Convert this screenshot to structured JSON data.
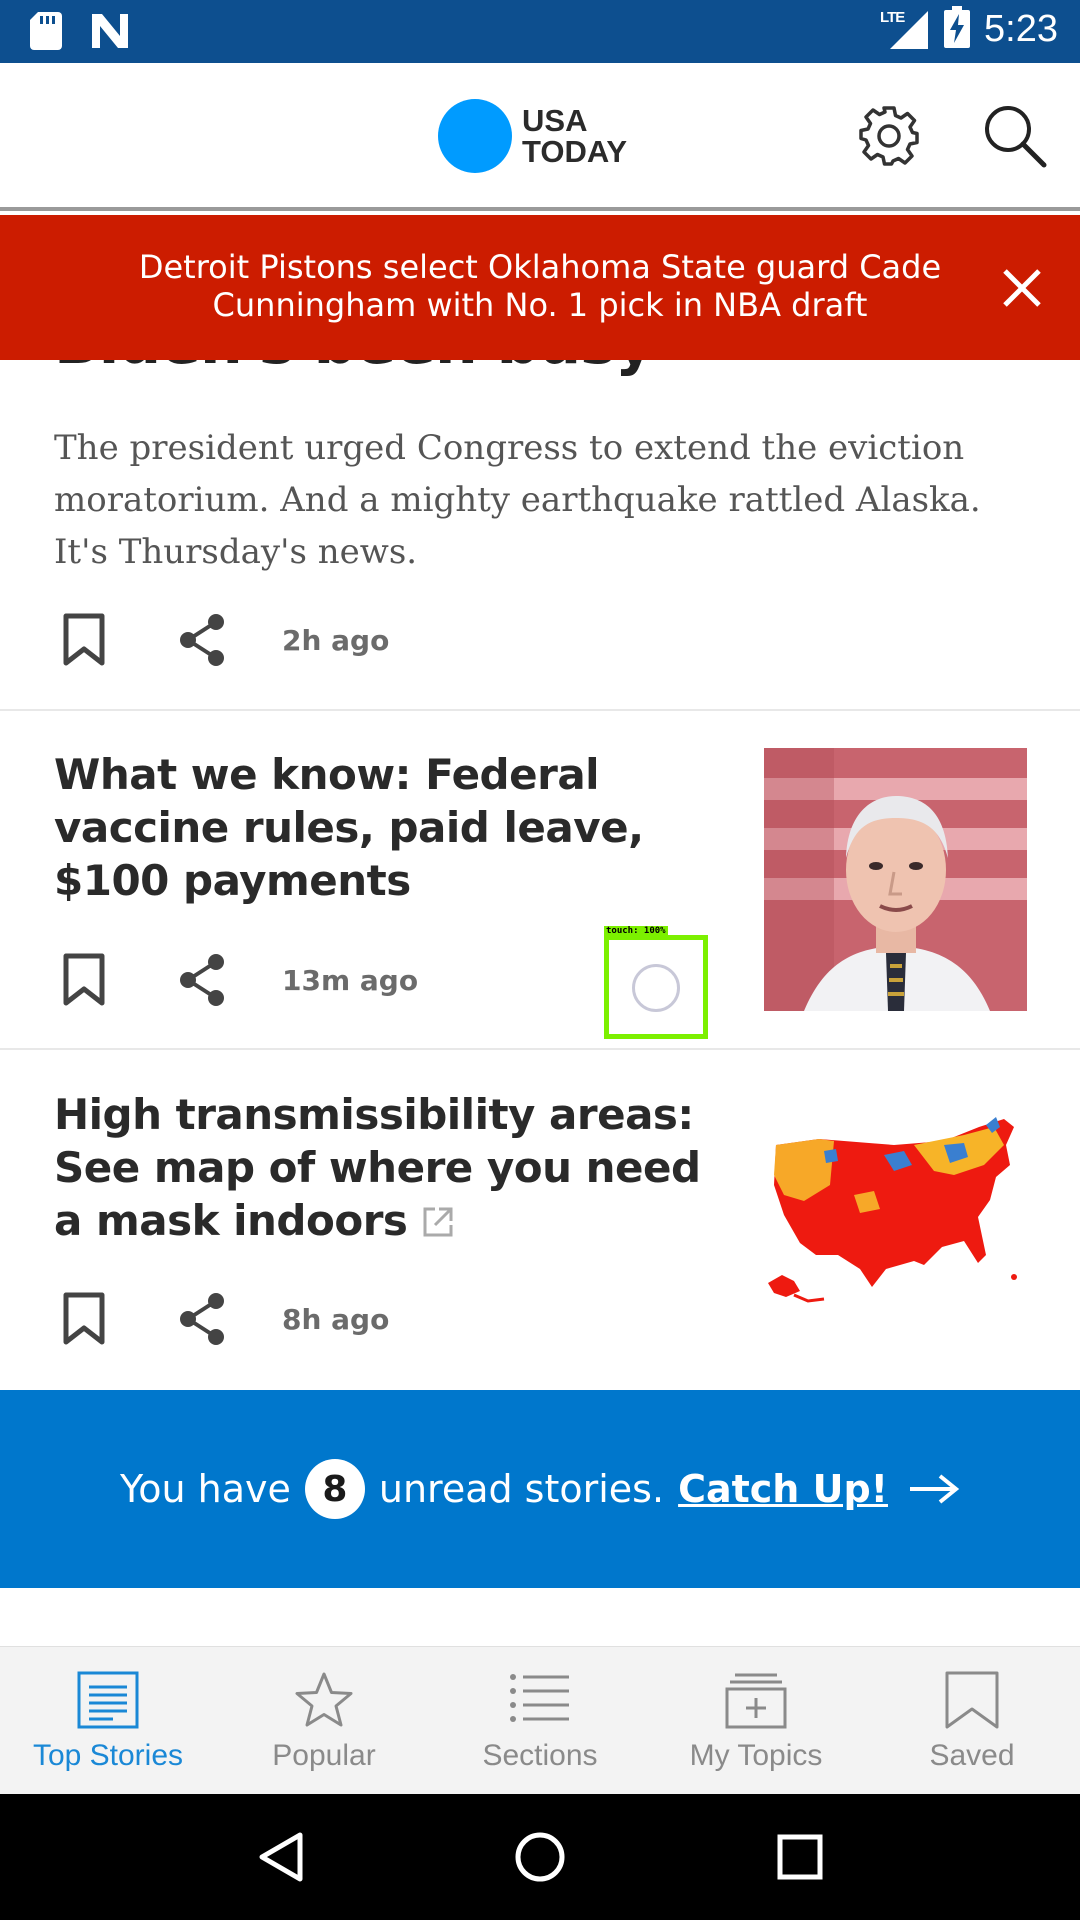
{
  "status_bar": {
    "time": "5:23",
    "network": "LTE",
    "icons": [
      "sd-card-icon",
      "n-notification-icon",
      "signal-icon",
      "battery-charging-icon"
    ]
  },
  "header": {
    "logo_line1": "USA",
    "logo_line2": "TODAY",
    "brand_color": "#009bff",
    "icons": [
      "gear-icon",
      "search-icon"
    ]
  },
  "banner": {
    "text": "Detroit Pistons select Oklahoma State guard Cade Cunningham with No. 1 pick in NBA draft",
    "color": "#cc1c00"
  },
  "feed": {
    "story0": {
      "headline_fragment": "Biden's been busy",
      "summary": "The president urged Congress to extend the eviction moratorium. And a mighty earthquake rattled Alaska. It's Thursday's news.",
      "time": "2h ago"
    },
    "story1": {
      "title": "What we know: Federal vaccine rules, paid leave, $100 payments",
      "time": "13m ago",
      "thumbnail": "portrait photo"
    },
    "story2": {
      "title": "High transmissibility areas: See map of where you need a mask indoors",
      "time": "8h ago",
      "thumbnail": "US map"
    },
    "touch_indicator": "touch: 100%"
  },
  "catchup": {
    "prefix": "You have",
    "count": "8",
    "suffix": "unread stories.",
    "link": "Catch Up!",
    "color": "#0077cc"
  },
  "bottom_nav": {
    "items": [
      {
        "label": "Top Stories",
        "icon": "top-stories-icon",
        "active": true
      },
      {
        "label": "Popular",
        "icon": "star-icon"
      },
      {
        "label": "Sections",
        "icon": "list-icon"
      },
      {
        "label": "My Topics",
        "icon": "folder-plus-icon"
      },
      {
        "label": "Saved",
        "icon": "bookmark-icon"
      }
    ],
    "active_color": "#1a88d6"
  },
  "system_nav": [
    "back-icon",
    "home-icon",
    "recents-icon"
  ]
}
